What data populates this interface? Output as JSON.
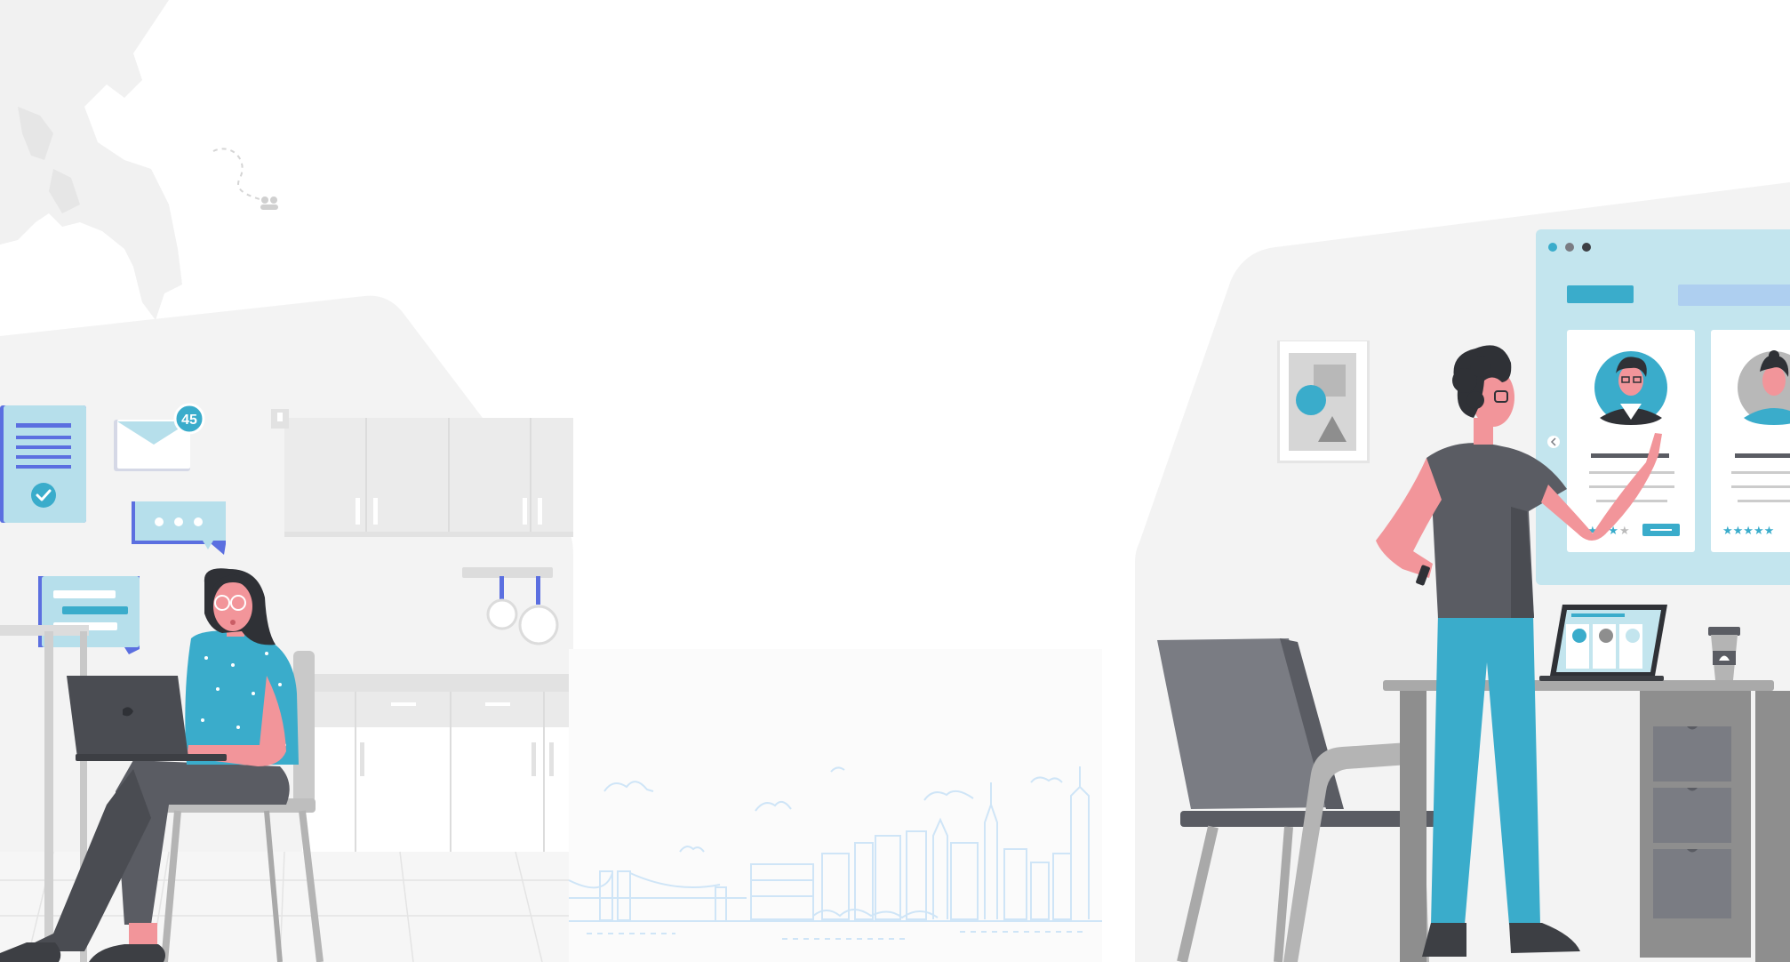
{
  "notification": {
    "unread_count": "45"
  },
  "colors": {
    "accent": "#3aaccb",
    "accent_light": "#c3e5ee",
    "indigo": "#5b6fe0",
    "dark_gray": "#5a5c63",
    "mid_gray": "#7a7c83",
    "light_gray": "#eeeeee",
    "skin": "#f2959a",
    "skyline_blue": "#cfe5f7"
  },
  "icons": [
    "location-pin-icon",
    "people-icon",
    "mail-icon",
    "checkmark-icon",
    "chat-dots-icon",
    "chevron-left-icon",
    "star-icon",
    "coffee-cup-icon",
    "laptop-icon"
  ],
  "ratings": {
    "card_1_stars": 3,
    "card_2_stars": 5,
    "stars_total": 5
  }
}
